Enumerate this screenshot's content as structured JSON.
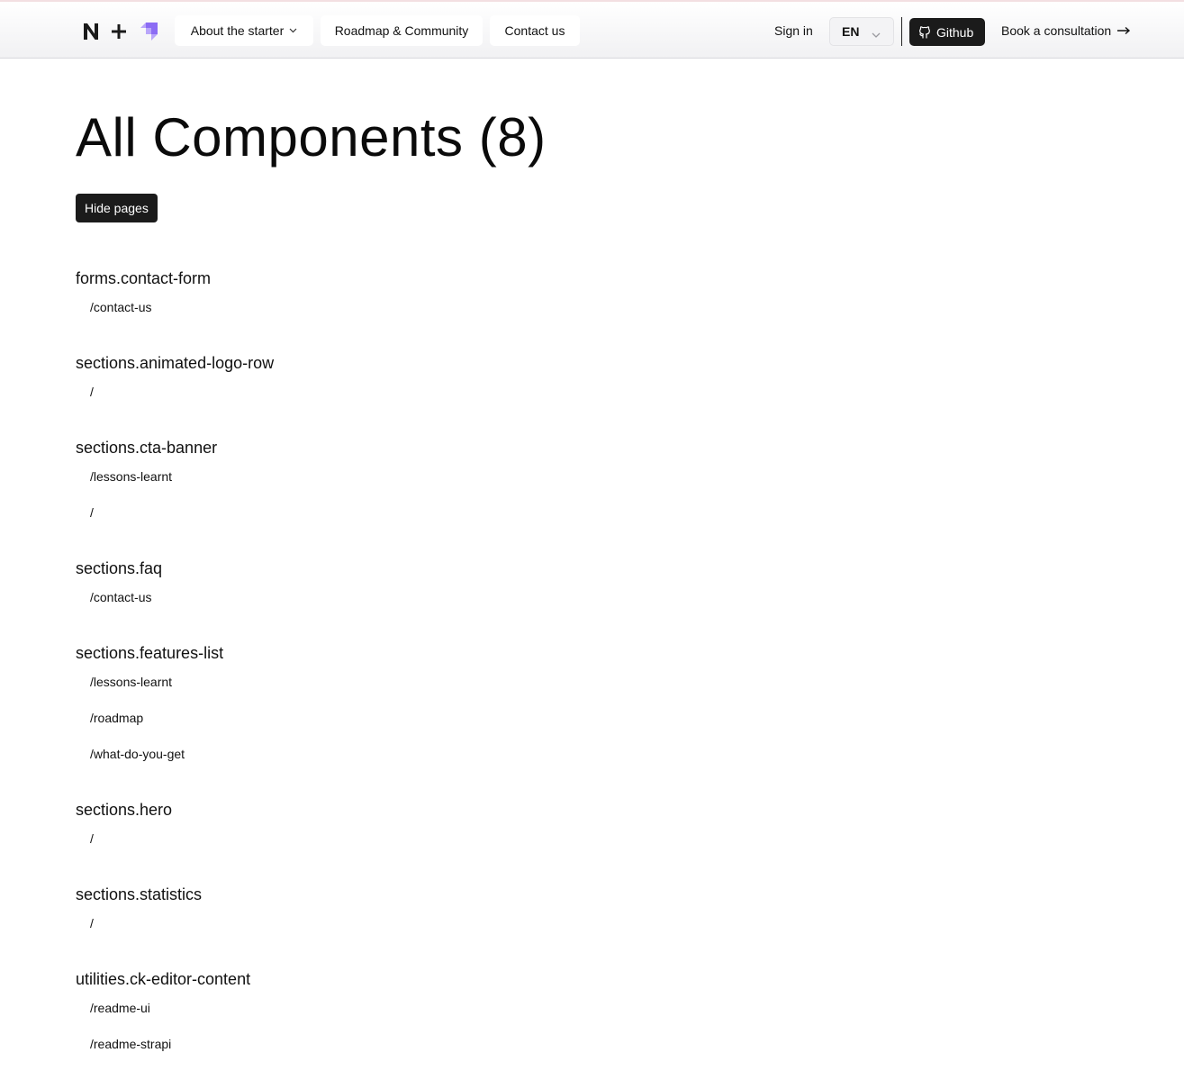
{
  "header": {
    "nav": {
      "about": "About the starter",
      "roadmap": "Roadmap & Community",
      "contact": "Contact us"
    },
    "sign_in": "Sign in",
    "language": "EN",
    "github": "Github",
    "consultation": "Book a consultation"
  },
  "main": {
    "title": "All Components (8)",
    "hide_pages": "Hide pages",
    "components": [
      {
        "name": "forms.contact-form",
        "pages": [
          "/contact-us"
        ]
      },
      {
        "name": "sections.animated-logo-row",
        "pages": [
          "/"
        ]
      },
      {
        "name": "sections.cta-banner",
        "pages": [
          "/lessons-learnt",
          "/"
        ]
      },
      {
        "name": "sections.faq",
        "pages": [
          "/contact-us"
        ]
      },
      {
        "name": "sections.features-list",
        "pages": [
          "/lessons-learnt",
          "/roadmap",
          "/what-do-you-get"
        ]
      },
      {
        "name": "sections.hero",
        "pages": [
          "/"
        ]
      },
      {
        "name": "sections.statistics",
        "pages": [
          "/"
        ]
      },
      {
        "name": "utilities.ck-editor-content",
        "pages": [
          "/readme-ui",
          "/readme-strapi"
        ]
      }
    ]
  },
  "colors": {
    "primary_button": "#1b1b1b",
    "strapi_purple": "#8c6cf4"
  }
}
